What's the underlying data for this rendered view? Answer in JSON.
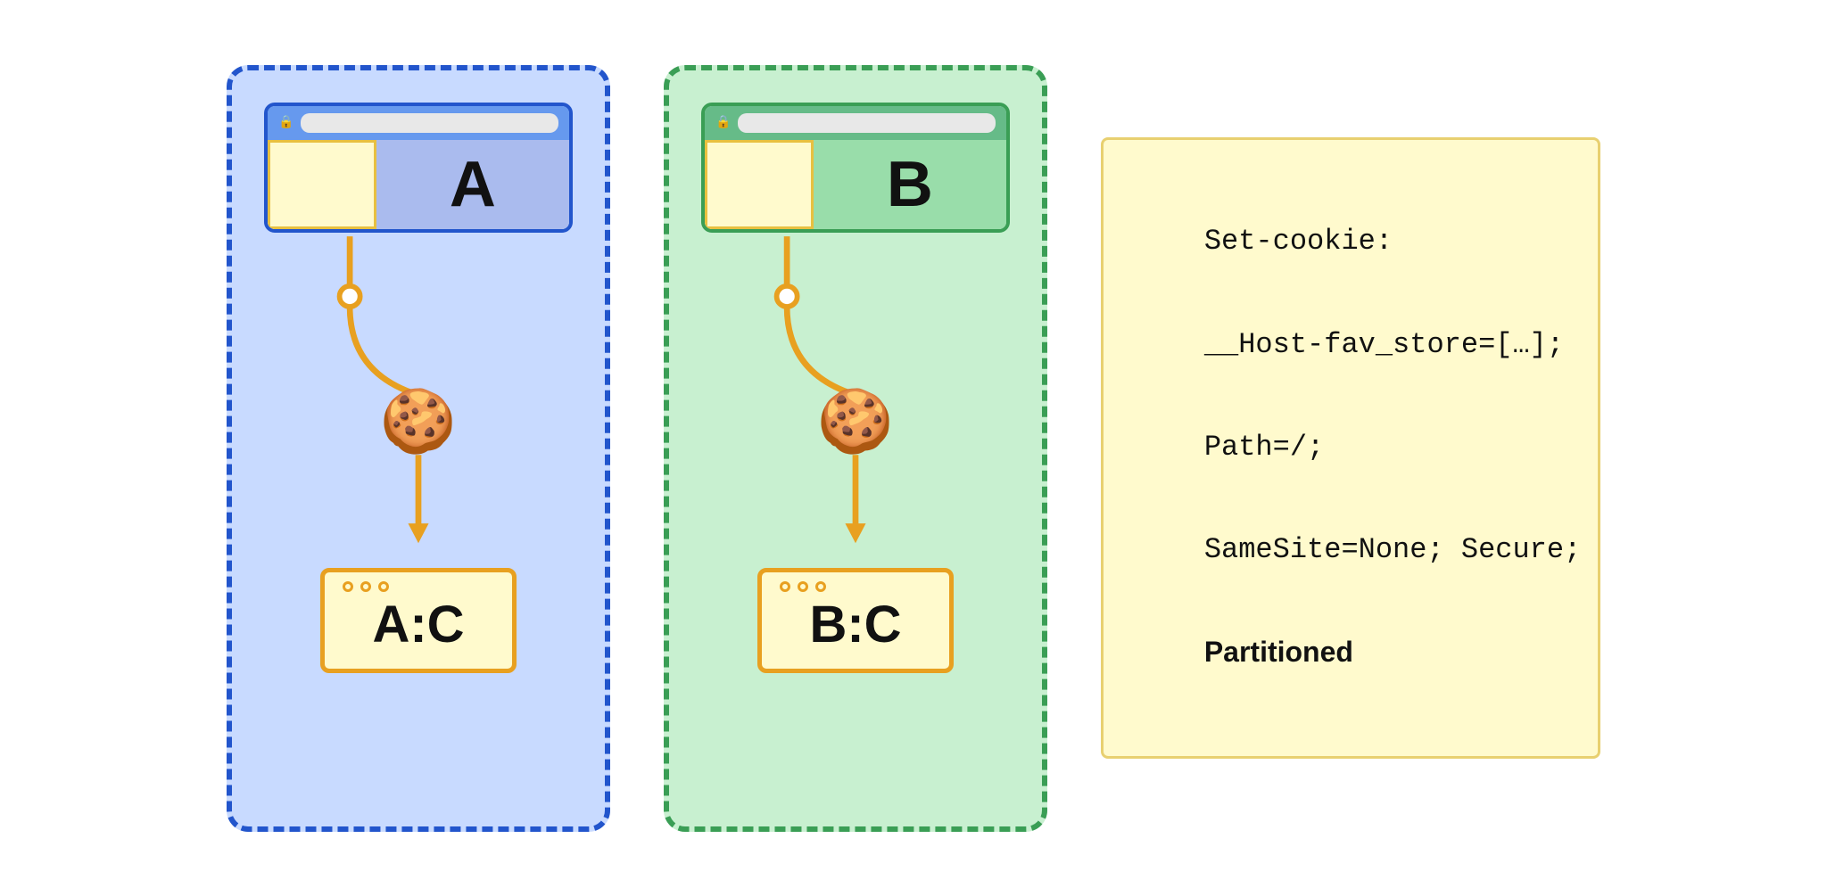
{
  "partitions": [
    {
      "id": "blue",
      "site_label": "A",
      "storage_label": "A:C",
      "color_scheme": "blue"
    },
    {
      "id": "green",
      "site_label": "B",
      "storage_label": "B:C",
      "color_scheme": "green"
    }
  ],
  "code_block": {
    "lines": [
      "Set-cookie:",
      "__Host-fav_store=[…];",
      "Path=/;",
      "SameSite=None; Secure;",
      "Partitioned"
    ]
  },
  "cookie_emoji": "🍪",
  "lock_icon": "🔒"
}
